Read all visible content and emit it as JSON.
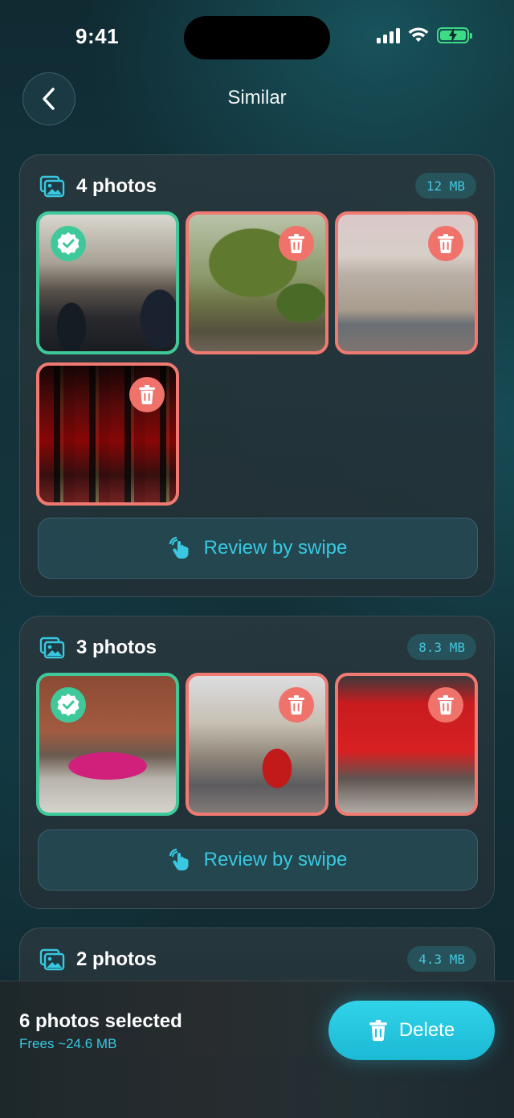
{
  "status_bar": {
    "time": "9:41"
  },
  "header": {
    "title": "Similar"
  },
  "groups": [
    {
      "title": "4 photos",
      "size": "12 MB",
      "review_label": "Review by swipe",
      "photos": [
        {
          "state": "keep",
          "subject": "subway escalator"
        },
        {
          "state": "delete",
          "subject": "tree in front of building"
        },
        {
          "state": "delete",
          "subject": "palace with crowd"
        },
        {
          "state": "delete",
          "subject": "guards in red uniforms"
        }
      ]
    },
    {
      "title": "3 photos",
      "size": "8.3 MB",
      "review_label": "Review by swipe",
      "photos": [
        {
          "state": "keep",
          "subject": "pink sports car"
        },
        {
          "state": "delete",
          "subject": "street with red bus"
        },
        {
          "state": "delete",
          "subject": "red double decker bus"
        }
      ]
    },
    {
      "title": "2 photos",
      "size": "4.3 MB"
    }
  ],
  "footer": {
    "selected_text": "6 photos selected",
    "frees_text": "Frees ~24.6 MB",
    "delete_label": "Delete"
  },
  "colors": {
    "accent": "#38c8e0",
    "keep": "#3fc99a",
    "delete": "#f07a72",
    "delete_button": "#22c6de"
  }
}
